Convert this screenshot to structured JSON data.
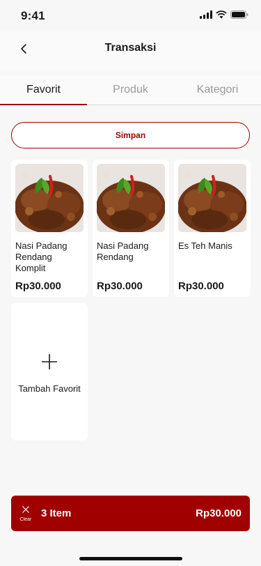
{
  "status": {
    "time": "9:41"
  },
  "header": {
    "title": "Transaksi",
    "back_icon": "chevron-left-icon"
  },
  "tabs": [
    {
      "label": "Favorit",
      "active": true
    },
    {
      "label": "Produk",
      "active": false
    },
    {
      "label": "Kategori",
      "active": false
    }
  ],
  "save_button": {
    "label": "Simpan"
  },
  "favorites": [
    {
      "name": "Nasi Padang Rendang Komplit",
      "price": "Rp30.000",
      "image": "rendang-photo"
    },
    {
      "name": "Nasi Padang Rendang",
      "price": "Rp30.000",
      "image": "rendang-photo"
    },
    {
      "name": "Es Teh Manis",
      "price": "Rp30.000",
      "image": "rendang-photo"
    }
  ],
  "add_favorite": {
    "label": "Tambah Favorit",
    "icon": "plus-icon"
  },
  "cart": {
    "clear_label": "Clear",
    "clear_icon": "close-icon",
    "item_count": "3 Item",
    "total": "Rp30.000"
  },
  "colors": {
    "accent": "#a00000",
    "background": "#f7f7f7",
    "card": "#ffffff"
  }
}
